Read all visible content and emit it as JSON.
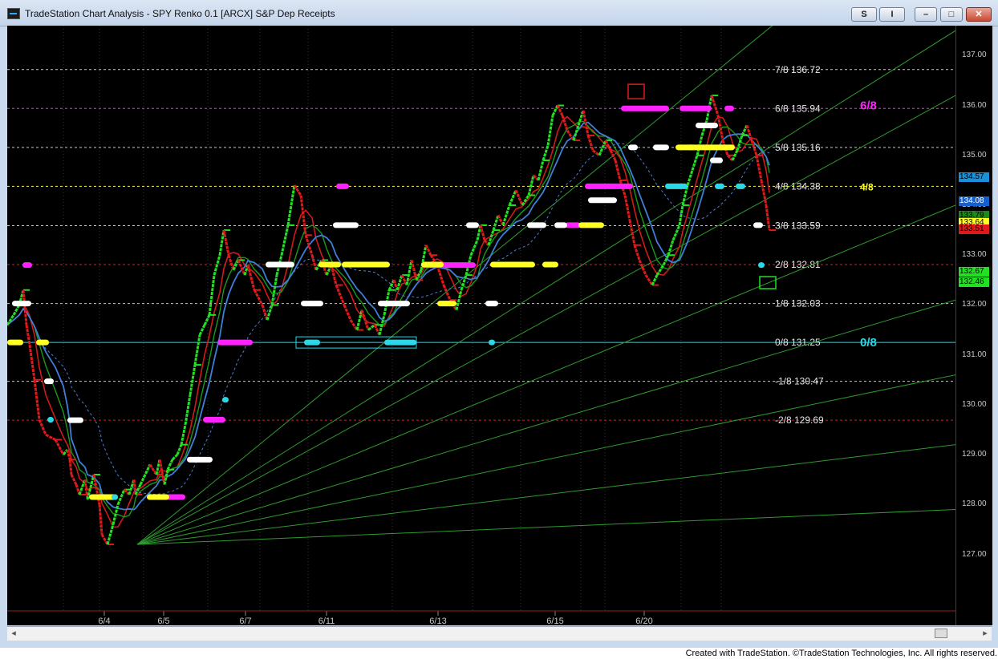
{
  "window": {
    "title": "TradeStation Chart Analysis - SPY Renko 0.1 [ARCX] S&P Dep Receipts",
    "buttons": {
      "s": "S",
      "i": "I",
      "min": "–",
      "max": "□",
      "close": "✕"
    },
    "credit": "Created with TradeStation. ©TradeStation Technologies, Inc. All rights reserved."
  },
  "colors": {
    "background": "#000000",
    "up_brick": "#22e022",
    "down_brick": "#e01a1a",
    "ma_blue": "#3f7fd8",
    "ma_green": "#1a9a1a",
    "ma_red": "#d11a1a",
    "gann_lines": "#2e9a2e",
    "magenta": "#ff22ff",
    "yellow": "#ffff22",
    "cyan": "#2ad8e8"
  },
  "chart_data": {
    "type": "line",
    "title": "SPY Renko 0.1 [ARCX]",
    "x_ticks": [
      "6/4",
      "6/5",
      "6/7",
      "6/11",
      "6/13",
      "6/15",
      "6/20"
    ],
    "y_ticks": [
      "137.00",
      "136.00",
      "135.00",
      "134.00",
      "133.00",
      "132.00",
      "131.00",
      "130.00",
      "129.00",
      "128.00",
      "127.00"
    ],
    "ylim": [
      125.9,
      137.6
    ],
    "price_series": {
      "name": "SPY",
      "x": [
        0,
        8,
        15,
        20,
        24,
        28,
        34,
        40,
        48,
        60,
        70,
        75,
        78,
        80,
        86,
        90,
        97,
        100,
        108,
        115,
        118,
        125,
        132,
        138,
        146,
        152,
        158,
        160,
        166,
        178,
        186,
        190,
        196,
        200,
        206,
        212,
        217,
        222,
        228,
        234,
        240,
        246,
        252,
        258,
        265,
        270,
        276,
        282,
        288,
        296,
        300,
        308,
        318,
        324,
        330,
        336,
        342,
        350,
        358,
        366,
        372,
        380,
        385,
        392,
        398,
        404,
        410,
        420,
        428,
        436,
        442,
        450,
        458,
        464,
        470,
        476,
        482,
        486,
        492,
        498,
        504,
        510,
        516,
        522,
        528,
        536,
        544,
        552,
        560,
        566,
        572,
        578,
        586,
        590,
        595,
        600,
        606,
        612,
        618,
        626,
        634,
        642,
        650,
        656,
        662,
        668,
        674,
        680,
        686,
        692,
        698,
        706,
        712,
        718,
        724,
        730,
        738,
        746,
        752,
        758,
        764,
        770,
        776,
        782,
        788,
        796,
        804,
        810,
        818,
        824,
        830,
        838,
        842,
        848,
        854,
        860,
        866,
        872,
        878,
        886,
        892,
        898,
        904,
        910,
        916,
        922,
        928,
        934,
        940,
        946,
        950
      ],
      "y": [
        131.6,
        131.8,
        132.0,
        132.3,
        131.6,
        131.2,
        130.5,
        129.7,
        129.4,
        129.3,
        129.0,
        129.1,
        128.9,
        128.6,
        128.4,
        128.2,
        128.5,
        128.1,
        128.6,
        128.0,
        127.4,
        127.2,
        127.6,
        128.0,
        128.3,
        128.2,
        128.5,
        128.2,
        128.4,
        128.8,
        128.6,
        128.9,
        128.4,
        128.7,
        128.9,
        129.0,
        129.2,
        129.6,
        130.2,
        130.8,
        131.4,
        131.6,
        131.8,
        132.6,
        133.0,
        133.5,
        133.0,
        132.7,
        132.9,
        132.6,
        132.8,
        132.3,
        132.0,
        131.7,
        132.0,
        132.6,
        133.0,
        133.6,
        134.4,
        134.2,
        133.4,
        133.0,
        132.7,
        132.9,
        132.6,
        132.8,
        132.4,
        132.0,
        131.7,
        131.5,
        131.9,
        131.5,
        131.6,
        131.4,
        131.8,
        132.3,
        132.5,
        132.3,
        132.6,
        132.4,
        132.9,
        132.5,
        132.7,
        133.2,
        133.0,
        132.8,
        132.4,
        132.1,
        131.9,
        132.3,
        132.6,
        133.0,
        133.3,
        133.6,
        133.3,
        133.2,
        133.5,
        133.8,
        133.6,
        134.0,
        134.3,
        134.0,
        134.2,
        134.6,
        134.5,
        134.9,
        135.2,
        135.8,
        136.0,
        135.8,
        135.5,
        135.3,
        135.6,
        135.9,
        135.4,
        135.1,
        135.0,
        135.3,
        135.1,
        134.9,
        134.5,
        134.2,
        133.7,
        133.2,
        132.9,
        132.6,
        132.4,
        132.6,
        132.8,
        133.0,
        133.3,
        133.6,
        134.0,
        134.4,
        134.7,
        135.0,
        135.4,
        135.7,
        136.2,
        135.8,
        135.3,
        135.0,
        134.9,
        135.1,
        135.4,
        135.6,
        135.3,
        135.0,
        134.5,
        134.0,
        133.5
      ]
    },
    "murrey_levels": [
      {
        "label": "7/8",
        "value": "136.72",
        "color": "#c8c8c8",
        "dash": "dashed"
      },
      {
        "label": "6/8",
        "value": "135.94",
        "color": "#ff22ff",
        "dash": "dashed"
      },
      {
        "label": "5/8",
        "value": "135.16",
        "color": "#c8c8c8",
        "dash": "dashed"
      },
      {
        "label": "4/8",
        "value": "134.38",
        "color": "#ffff22",
        "dash": "dashed"
      },
      {
        "label": "3/8",
        "value": "133.59",
        "color": "#c8c8c8",
        "dash": "dashed"
      },
      {
        "label": "2/8",
        "value": "132.81",
        "color": "#e01a1a",
        "dash": "dashed"
      },
      {
        "label": "1/8",
        "value": "132.03",
        "color": "#c8c8c8",
        "dash": "dashed"
      },
      {
        "label": "0/8",
        "value": "131.25",
        "color": "#2ad8e8",
        "dash": "solid"
      },
      {
        "label": "-1/8",
        "value": "130.47",
        "color": "#c8c8c8",
        "dash": "dashed"
      },
      {
        "label": "-2/8",
        "value": "129.69",
        "color": "#e01a1a",
        "dash": "dashed"
      }
    ],
    "side_labels": [
      {
        "text": "6/8",
        "value": 136.0,
        "color": "#ff22ff"
      },
      {
        "text": "4/8",
        "value": 134.38,
        "color": "#ffff22"
      },
      {
        "text": "0/8",
        "value": 131.25,
        "color": "#2ad8e8"
      }
    ],
    "price_labels": [
      {
        "text": "134.57",
        "value": 134.57,
        "bg": "#1b8fd8",
        "fg": "#000000"
      },
      {
        "text": "134.08",
        "value": 134.08,
        "bg": "#1560d0",
        "fg": "#ffffff"
      },
      {
        "text": "133.79",
        "value": 133.79,
        "bg": "#1a8a1a",
        "fg": "#000000"
      },
      {
        "text": "133.64",
        "value": 133.64,
        "bg": "#ffff22",
        "fg": "#000000"
      },
      {
        "text": "133.51",
        "value": 133.51,
        "bg": "#e01a1a",
        "fg": "#000000"
      },
      {
        "text": "132.67",
        "value": 132.67,
        "bg": "#22e022",
        "fg": "#000000"
      },
      {
        "text": "132.46",
        "value": 132.46,
        "bg": "#22e022",
        "fg": "#000000"
      }
    ],
    "gann_fan": {
      "origin": [
        162,
        127.2
      ],
      "end_values_at_right_edge": [
        140.6,
        137.5,
        136.2,
        134.0,
        132.1,
        130.6,
        129.2,
        127.9
      ]
    }
  }
}
